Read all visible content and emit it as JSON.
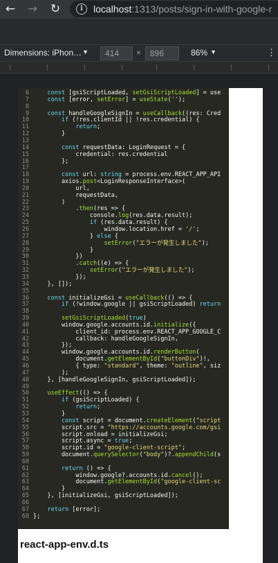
{
  "browser": {
    "url_host": "localhost",
    "url_path": ":1313/posts/sign-in-with-google-r"
  },
  "device_toolbar": {
    "dimensions_label": "Dimensions: iPhon…",
    "width": "414",
    "height": "896",
    "zoom": "86%"
  },
  "code_lines": [
    {
      "n": "6",
      "t": "    const [gsiScriptLoaded, setGsiScriptLoaded] = use"
    },
    {
      "n": "7",
      "t": "    const [error, setError] = useState('');"
    },
    {
      "n": "8",
      "t": ""
    },
    {
      "n": "9",
      "t": "    const handleGoogleSignIn = useCallback((res: Cred"
    },
    {
      "n": "10",
      "t": "        if (!res.clientId || !res.credential) {"
    },
    {
      "n": "11",
      "t": "            return;"
    },
    {
      "n": "12",
      "t": "        }"
    },
    {
      "n": "13",
      "t": ""
    },
    {
      "n": "14",
      "t": "        const requestData: LoginRequest = {"
    },
    {
      "n": "15",
      "t": "            credential: res.credential"
    },
    {
      "n": "16",
      "t": "        };"
    },
    {
      "n": "17",
      "t": ""
    },
    {
      "n": "18",
      "t": "        const url: string = process.env.REACT_APP_API"
    },
    {
      "n": "19",
      "t": "        axios.post<LoginResponseInterface>("
    },
    {
      "n": "20",
      "t": "            url,"
    },
    {
      "n": "21",
      "t": "            requestData,"
    },
    {
      "n": "22",
      "t": "        )"
    },
    {
      "n": "23",
      "t": "            .then(res => {"
    },
    {
      "n": "24",
      "t": "                console.log(res.data.result);"
    },
    {
      "n": "25",
      "t": "                if (res.data.result) {"
    },
    {
      "n": "26",
      "t": "                    window.location.href = '/';"
    },
    {
      "n": "27",
      "t": "                } else {"
    },
    {
      "n": "28",
      "t": "                    setError(\"エラーが発生しました\");"
    },
    {
      "n": "29",
      "t": "                }"
    },
    {
      "n": "30",
      "t": "            })"
    },
    {
      "n": "31",
      "t": "            .catch((e) => {"
    },
    {
      "n": "32",
      "t": "                setError(\"エラーが発生しました\");"
    },
    {
      "n": "33",
      "t": "            });"
    },
    {
      "n": "34",
      "t": "    }, []);"
    },
    {
      "n": "35",
      "t": ""
    },
    {
      "n": "36",
      "t": "    const initializeGsi = useCallback(() => {"
    },
    {
      "n": "37",
      "t": "        if (!window.google || gsiScriptLoaded) return"
    },
    {
      "n": "38",
      "t": ""
    },
    {
      "n": "39",
      "t": "        setGsiScriptLoaded(true)"
    },
    {
      "n": "40",
      "t": "        window.google.accounts.id.initialize({"
    },
    {
      "n": "41",
      "t": "            client_id: process.env.REACT_APP_GOOGLE_C"
    },
    {
      "n": "42",
      "t": "            callback: handleGoogleSignIn,"
    },
    {
      "n": "43",
      "t": "        });"
    },
    {
      "n": "44",
      "t": "        window.google.accounts.id.renderButton("
    },
    {
      "n": "45",
      "t": "            document.getElementById(\"buttonDiv\")!,"
    },
    {
      "n": "46",
      "t": "            { type: \"standard\", theme: \"outline\", siz"
    },
    {
      "n": "47",
      "t": "        );"
    },
    {
      "n": "48",
      "t": "    }, [handleGoogleSignIn, gsiScriptLoaded]);"
    },
    {
      "n": "49",
      "t": ""
    },
    {
      "n": "50",
      "t": "    useEffect(() => {"
    },
    {
      "n": "51",
      "t": "        if (gsiScriptLoaded) {"
    },
    {
      "n": "52",
      "t": "            return;"
    },
    {
      "n": "53",
      "t": "        }"
    },
    {
      "n": "54",
      "t": "        const script = document.createElement(\"script"
    },
    {
      "n": "55",
      "t": "        script.src = \"https://accounts.google.com/gsi"
    },
    {
      "n": "56",
      "t": "        script.onload = initializeGsi;"
    },
    {
      "n": "57",
      "t": "        script.async = true;"
    },
    {
      "n": "58",
      "t": "        script.id = \"google-client-script\";"
    },
    {
      "n": "59",
      "t": "        document.querySelector(\"body\")?.appendChild(s"
    },
    {
      "n": "60",
      "t": ""
    },
    {
      "n": "61",
      "t": "        return () => {"
    },
    {
      "n": "62",
      "t": "            window.google?.accounts.id.cancel();"
    },
    {
      "n": "63",
      "t": "            document.getElementById(\"google-client-sc"
    },
    {
      "n": "64",
      "t": "        }"
    },
    {
      "n": "65",
      "t": "    }, [initializeGsi, gsiScriptLoaded]);"
    },
    {
      "n": "66",
      "t": ""
    },
    {
      "n": "67",
      "t": "    return [error];"
    },
    {
      "n": "68",
      "t": "};"
    }
  ],
  "filename": "react-app-env.d.ts",
  "colors": {
    "code_background": "#272822",
    "keyword": "#66d9ef",
    "function": "#a6e22e",
    "string": "#e6db74"
  }
}
